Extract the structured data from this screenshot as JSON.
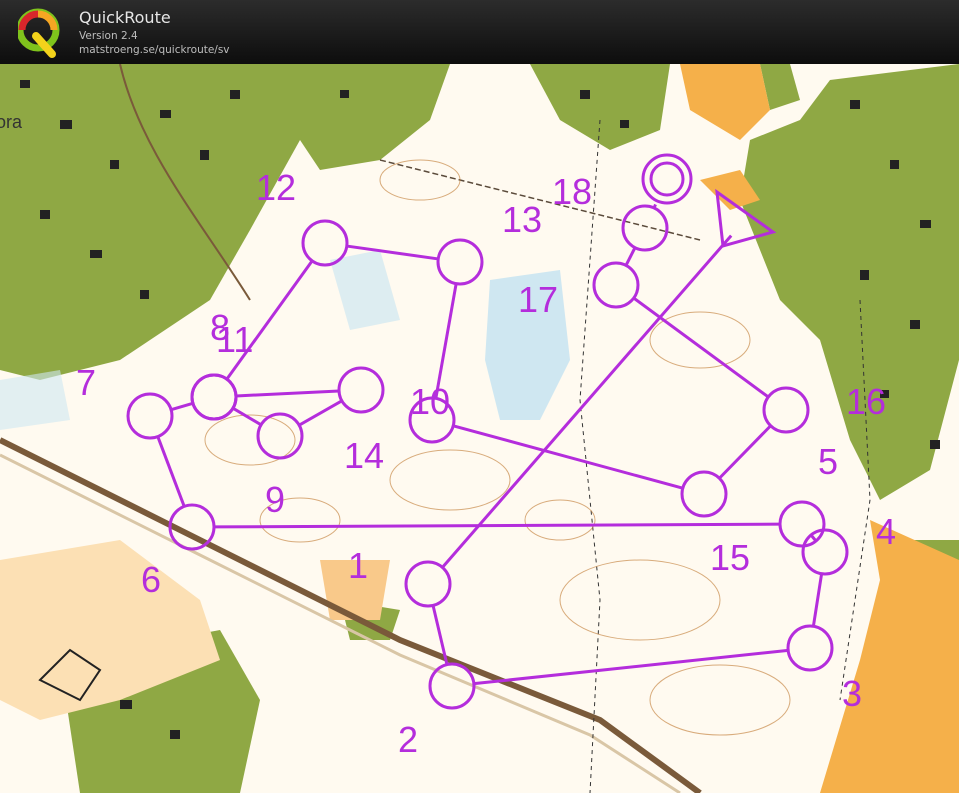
{
  "app": {
    "name": "QuickRoute",
    "version": "Version 2.4",
    "url": "matstroeng.se/quickroute/sv"
  },
  "map": {
    "partial_label": "ora",
    "course_color": "#b42ddc",
    "controls": [
      {
        "id": "start",
        "label": ""
      },
      {
        "id": "c1",
        "label": "1"
      },
      {
        "id": "c2",
        "label": "2"
      },
      {
        "id": "c3",
        "label": "3"
      },
      {
        "id": "c4",
        "label": "4"
      },
      {
        "id": "c5",
        "label": "5"
      },
      {
        "id": "c6",
        "label": "6"
      },
      {
        "id": "c7",
        "label": "7"
      },
      {
        "id": "c8",
        "label": "8"
      },
      {
        "id": "c9",
        "label": "9"
      },
      {
        "id": "c10",
        "label": "10"
      },
      {
        "id": "c11",
        "label": "11"
      },
      {
        "id": "c12",
        "label": "12"
      },
      {
        "id": "c13",
        "label": "13"
      },
      {
        "id": "c14",
        "label": "14"
      },
      {
        "id": "c15",
        "label": "15"
      },
      {
        "id": "c16",
        "label": "16"
      },
      {
        "id": "c17",
        "label": "17"
      },
      {
        "id": "c18",
        "label": "18"
      },
      {
        "id": "finish",
        "label": ""
      }
    ]
  }
}
